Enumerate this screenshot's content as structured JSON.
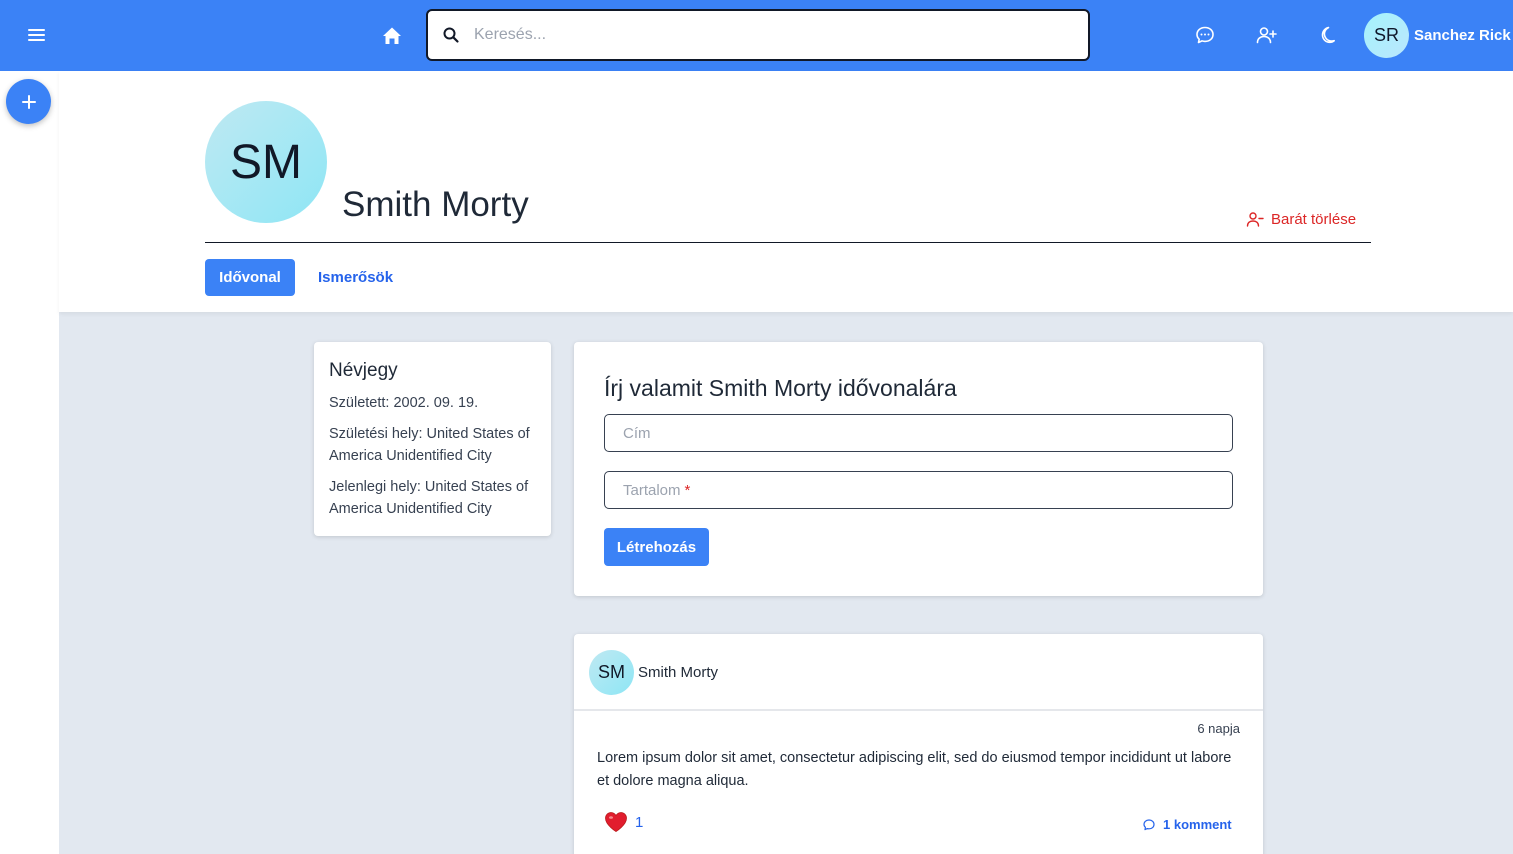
{
  "topbar": {
    "search_placeholder": "Keresés...",
    "user_initials": "SR",
    "user_name": "Sanchez Rick",
    "accent_color": "#3b82f6",
    "icons": [
      "menu-icon",
      "home-icon",
      "search-icon",
      "messages-icon",
      "add-friend-icon",
      "dark-mode-icon"
    ]
  },
  "profile": {
    "initials": "SM",
    "name": "Smith Morty",
    "remove_friend_label": "Barát törlése",
    "tabs": [
      {
        "label": "Idővonal",
        "active": true
      },
      {
        "label": "Ismerősök",
        "active": false
      }
    ]
  },
  "about": {
    "title": "Névjegy",
    "born": "Született: 2002. 09. 19.",
    "birthplace": "Születési hely: United States of America Unidentified City",
    "current_place": "Jelenlegi hely: United States of America Unidentified City"
  },
  "post_form": {
    "title": "Írj valamit Smith Morty idővonalára",
    "title_placeholder": "Cím",
    "content_placeholder": "Tartalom",
    "required_mark": "*",
    "submit_label": "Létrehozás"
  },
  "post": {
    "author_initials": "SM",
    "author": "Smith Morty",
    "time": "6 napja",
    "body": "Lorem ipsum dolor sit amet, consectetur adipiscing elit, sed do eiusmod tempor incididunt ut labore et dolore magna aliqua.",
    "likes": "1",
    "comments": "1 komment"
  }
}
